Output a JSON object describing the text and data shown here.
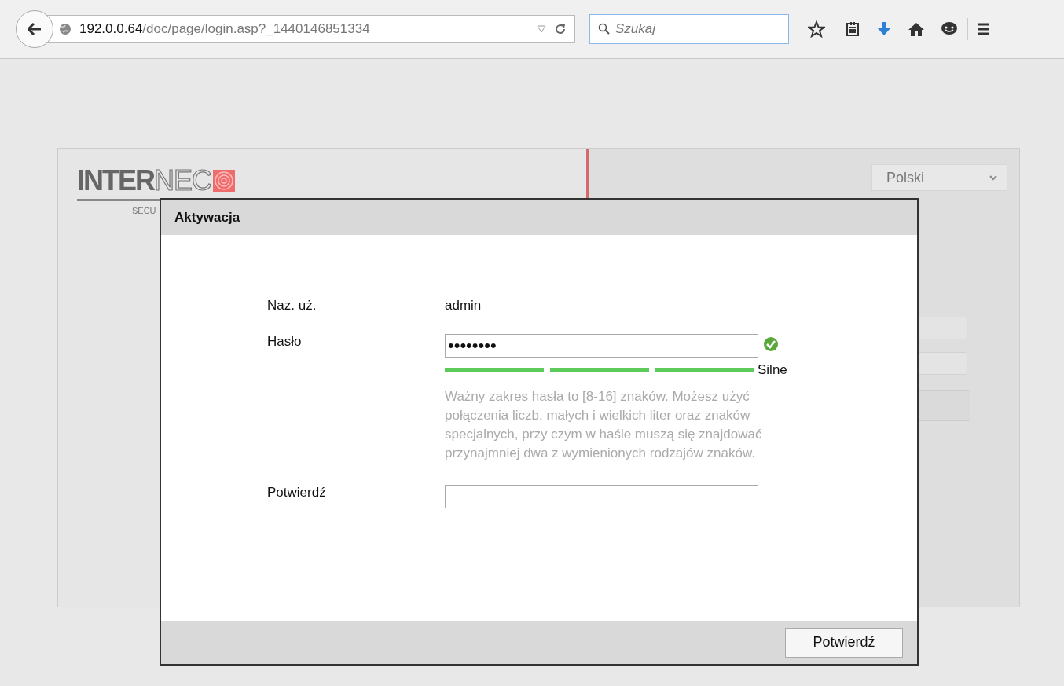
{
  "browser": {
    "url_host": "192.0.0.64",
    "url_path": "/doc/page/login.asp?_1440146851334",
    "search_placeholder": "Szukaj"
  },
  "login_page": {
    "logo_strong": "INTER",
    "logo_light": "NEC",
    "logo_tagline": "SECU",
    "language": "Polski"
  },
  "dialog": {
    "title": "Aktywacja",
    "username_label": "Naz. uż.",
    "username": "admin",
    "password_label": "Hasło",
    "password_value": "••••••••",
    "password_valid": true,
    "strength": {
      "level": 1,
      "label": "Silne"
    },
    "hint": "Ważny zakres hasła to [8-16] znaków. Możesz użyć połączenia liczb, małych i wielkich liter oraz znaków specjalnych, przy czym w haśle muszą się znajdować przynajmniej dwa z wymienionych rodzajów znaków.",
    "confirm_label": "Potwierdź",
    "confirm_button": "Potwierdź"
  }
}
